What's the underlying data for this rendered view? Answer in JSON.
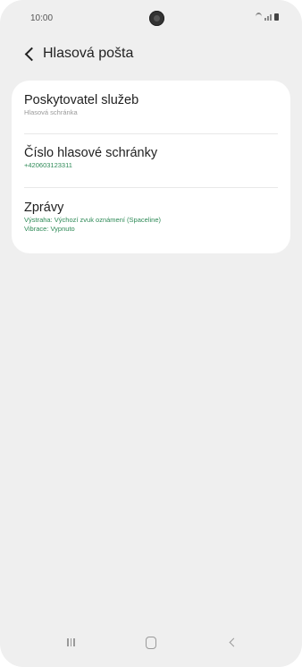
{
  "status_bar": {
    "time": "10:00"
  },
  "header": {
    "title": "Hlasová pošta",
    "back_icon": "chevron-left-icon"
  },
  "settings": {
    "items": [
      {
        "title": "Poskytovatel služeb",
        "subtitle": "Hlasová schránka"
      },
      {
        "title": "Číslo hlasové schránky",
        "subtitle": "+420603123311"
      },
      {
        "title": "Zprávy",
        "subtitle_line1": "Výstraha: Výchozí zvuk oznámení (Spaceline)",
        "subtitle_line2": "Vibrace: Vypnuto"
      }
    ]
  },
  "nav_bar": {
    "icons": [
      "recent-apps-icon",
      "home-icon",
      "back-icon"
    ]
  },
  "colors": {
    "background": "#efefef",
    "card": "#ffffff",
    "accent_green": "#2e8a57",
    "subtitle_gray": "#9a9a9a"
  }
}
